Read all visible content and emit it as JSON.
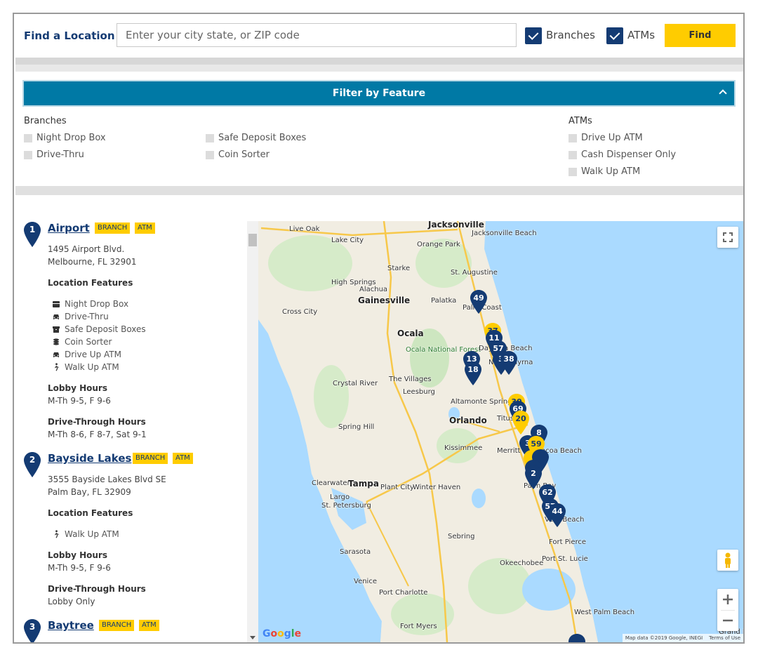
{
  "search": {
    "label": "Find a Location",
    "placeholder": "Enter your city state, or ZIP code",
    "value": "",
    "branches_label": "Branches",
    "atms_label": "ATMs",
    "find_label": "Find"
  },
  "filter": {
    "title": "Filter by Feature",
    "branches_title": "Branches",
    "atms_title": "ATMs",
    "branch_options": [
      "Night Drop Box",
      "Safe Deposit Boxes",
      "Drive-Thru",
      "Coin Sorter"
    ],
    "atm_options": [
      "Drive Up ATM",
      "Cash Dispenser Only",
      "Walk Up ATM"
    ]
  },
  "labels": {
    "location_features": "Location Features",
    "lobby_hours": "Lobby Hours",
    "drive_through_hours": "Drive-Through Hours",
    "branch_badge": "BRANCH",
    "atm_badge": "ATM"
  },
  "locations": [
    {
      "number": "1",
      "name": "Airport",
      "address1": "1495 Airport Blvd.",
      "address2": "Melbourne, FL 32901",
      "features": [
        "Night Drop Box",
        "Drive-Thru",
        "Safe Deposit Boxes",
        "Coin Sorter",
        "Drive Up ATM",
        "Walk Up ATM"
      ],
      "lobby_hours": "M-Th 9-5, F 9-6",
      "drive_hours": "M-Th 8-6, F 8-7, Sat 9-1"
    },
    {
      "number": "2",
      "name": "Bayside Lakes",
      "address1": "3555 Bayside Lakes Blvd SE",
      "address2": "Palm Bay, FL 32909",
      "features": [
        "Walk Up ATM"
      ],
      "lobby_hours": "M-Th 9-5, F 9-6",
      "drive_hours": "Lobby Only"
    },
    {
      "number": "3",
      "name": "Baytree"
    }
  ],
  "map": {
    "places": [
      "Jacksonville",
      "Jacksonville Beach",
      "Orange Park",
      "Lake City",
      "Live Oak",
      "St. Augustine",
      "Starke",
      "High Springs",
      "Alachua",
      "Gainesville",
      "Palatka",
      "Palm Coast",
      "Cross City",
      "Ocala",
      "Ocala National Forest",
      "Daytona Beach",
      "New Smyrna",
      "Crystal River",
      "The Villages",
      "Leesburg",
      "Altamonte Springs",
      "Orlando",
      "Titusville",
      "Spring Hill",
      "Kissimmee",
      "Merritt Island",
      "Cocoa Beach",
      "Clearwater",
      "Tampa",
      "Plant City",
      "Winter Haven",
      "Largo",
      "St. Petersburg",
      "Palm Bay",
      "Vero Beach",
      "Sebring",
      "Fort Pierce",
      "Sarasota",
      "Okeechobee",
      "Port St. Lucie",
      "Venice",
      "Port Charlotte",
      "Fort Myers",
      "West Palm Beach",
      "Grand Ba"
    ],
    "pins": [
      {
        "n": "49",
        "c": "blue"
      },
      {
        "n": "37",
        "c": "yellow"
      },
      {
        "n": "11",
        "c": "blue"
      },
      {
        "n": "57",
        "c": "blue"
      },
      {
        "n": "13",
        "c": "blue"
      },
      {
        "n": "3",
        "c": "blue"
      },
      {
        "n": "38",
        "c": "blue"
      },
      {
        "n": "18",
        "c": "blue"
      },
      {
        "n": "30",
        "c": "yellow"
      },
      {
        "n": "69",
        "c": "blue"
      },
      {
        "n": "20",
        "c": "yellow"
      },
      {
        "n": "8",
        "c": "blue"
      },
      {
        "n": "3",
        "c": "blue"
      },
      {
        "n": "59",
        "c": "yellow"
      },
      {
        "n": "2",
        "c": "blue"
      },
      {
        "n": "62",
        "c": "blue"
      },
      {
        "n": "57",
        "c": "blue"
      },
      {
        "n": "44",
        "c": "blue"
      }
    ],
    "google": "Google",
    "attribution": "Map data ©2019 Google, INEGI",
    "terms": "Terms of Use"
  },
  "colors": {
    "navy": "#143b73",
    "accent": "#ffcc00",
    "filter_bar": "#0079a5"
  }
}
